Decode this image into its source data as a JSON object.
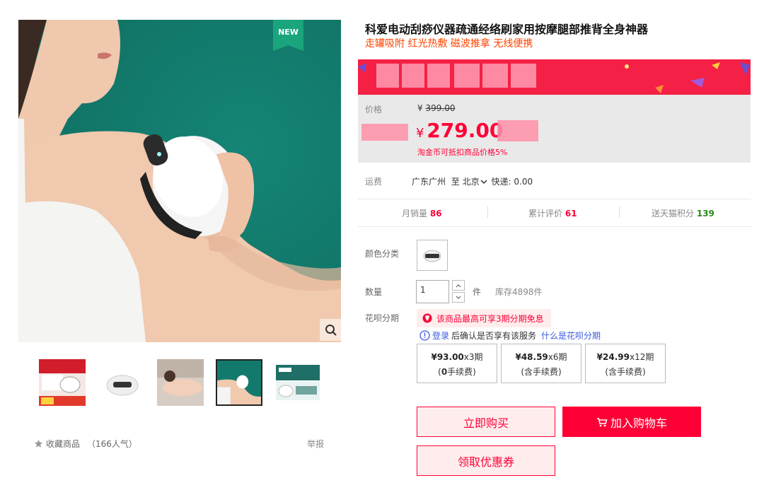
{
  "product": {
    "title": "科爱电动刮痧仪器疏通经络刷家用按摩腿部推背全身神器",
    "subtitle": "走罐吸附 红光热敷 磁波推拿 无线便携",
    "new_badge": "NEW"
  },
  "gallery": {
    "main_image": "product-photo-woman-using-massager-on-shoulder",
    "thumbnails": [
      {
        "name": "thumb-promo-box",
        "active": false
      },
      {
        "name": "thumb-device-white",
        "active": false
      },
      {
        "name": "thumb-back-massage",
        "active": false
      },
      {
        "name": "thumb-shoulder-use",
        "active": true
      },
      {
        "name": "thumb-packaging",
        "active": false
      }
    ],
    "favorite_label": "收藏商品",
    "popularity": "（166人气）",
    "report_label": "举报"
  },
  "pricing": {
    "price_label": "价格",
    "original_currency": "¥",
    "original_price": "399.00",
    "currency": "¥",
    "current_price": "279.00",
    "coin_note": "淘金币可抵扣商品价格5%"
  },
  "shipping": {
    "label": "运费",
    "origin": "广东广州",
    "to": "至",
    "destination": "北京",
    "express": "快递: 0.00"
  },
  "stats": {
    "monthly_sales_label": "月销量",
    "monthly_sales": "86",
    "reviews_label": "累计评价",
    "reviews": "61",
    "points_label": "送天猫积分",
    "points": "139"
  },
  "options": {
    "color_label": "颜色分类",
    "qty_label": "数量",
    "qty_value": "1",
    "qty_unit": "件",
    "stock": "库存4898件"
  },
  "huabei": {
    "label": "花呗分期",
    "promo": "该商品最高可享3期分期免息",
    "login": "登录",
    "confirm_text": "后确认是否享有该服务",
    "what_is": "什么是花呗分期",
    "plans": [
      {
        "amount": "¥93.00",
        "periods": "x3期",
        "fee_prefix": "(",
        "fee_bold": "0",
        "fee_suffix": "手续费)"
      },
      {
        "amount": "¥48.59",
        "periods": "x6期",
        "fee_prefix": "(",
        "fee_bold": "",
        "fee_suffix": "含手续费)"
      },
      {
        "amount": "¥24.99",
        "periods": "x12期",
        "fee_prefix": "(",
        "fee_bold": "",
        "fee_suffix": "含手续费)"
      }
    ]
  },
  "actions": {
    "buy_now": "立即购买",
    "add_to_cart": "加入购物车",
    "get_coupon": "领取优惠券"
  },
  "colors": {
    "accent": "#ff0036",
    "subtitle": "#ff4400",
    "teal": "#127a6c",
    "new_badge": "#1aa57c",
    "points_green": "#2a8b16",
    "link_blue": "#3c5ade"
  }
}
